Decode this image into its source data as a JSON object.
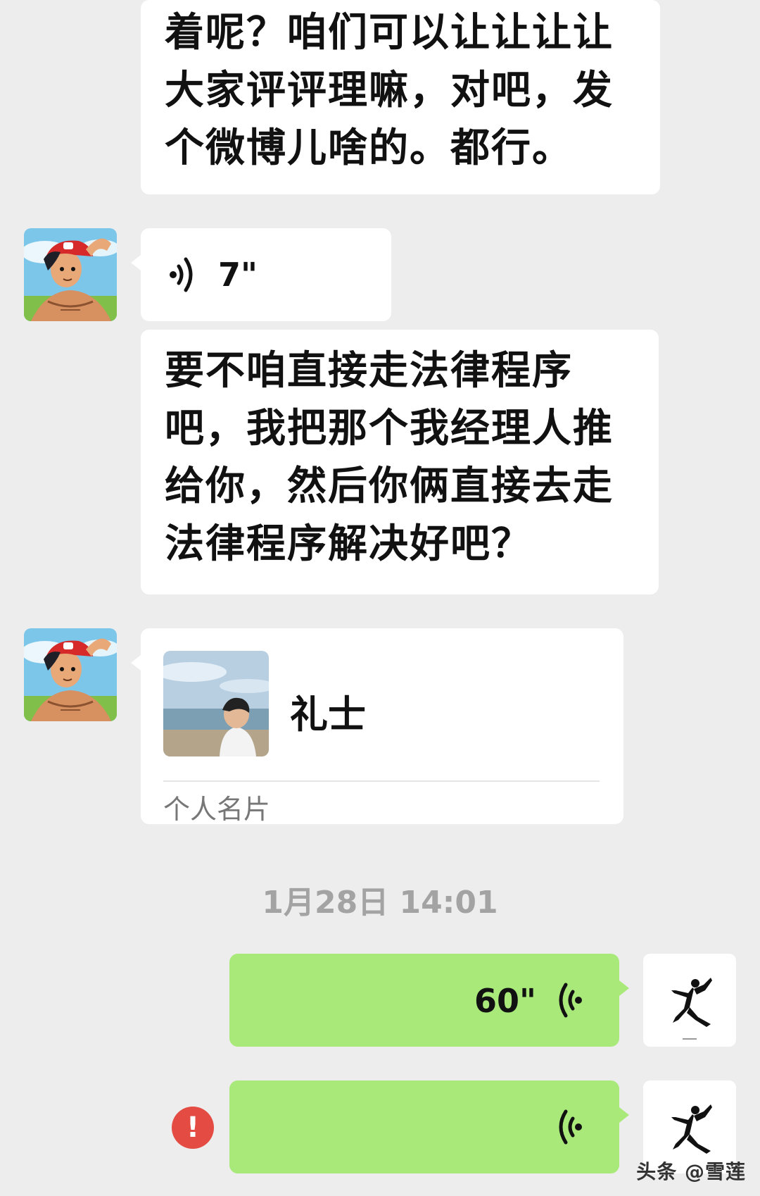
{
  "messages": {
    "msg1_lines": [
      "着呢？咱们可以让让让让",
      "大家评评理嘛，对吧，发",
      "个微博儿啥的。都行。"
    ],
    "voice1_duration": "7\"",
    "msg2_lines": [
      "要不咱直接走法律程序",
      "吧，我把那个我经理人推",
      "给你，然后你俩直接去走",
      "法律程序解决好吧？"
    ],
    "contact_card": {
      "name": "礼士",
      "type_label": "个人名片"
    },
    "timestamp": "1月28日 14:01",
    "voice_out1_duration": "60\"",
    "voice_out2_duration": "",
    "error_symbol": "!"
  },
  "watermark": "头条 @雪莲",
  "icons": {
    "voice_in": "voice-wave-icon",
    "voice_out": "voice-wave-icon",
    "error": "exclamation-icon",
    "user_avatar": "jumpman-logo"
  },
  "colors": {
    "background": "#ededed",
    "incoming_bubble": "#ffffff",
    "outgoing_bubble": "#a9e97a",
    "error": "#e44b43",
    "timestamp": "#a3a3a3"
  }
}
